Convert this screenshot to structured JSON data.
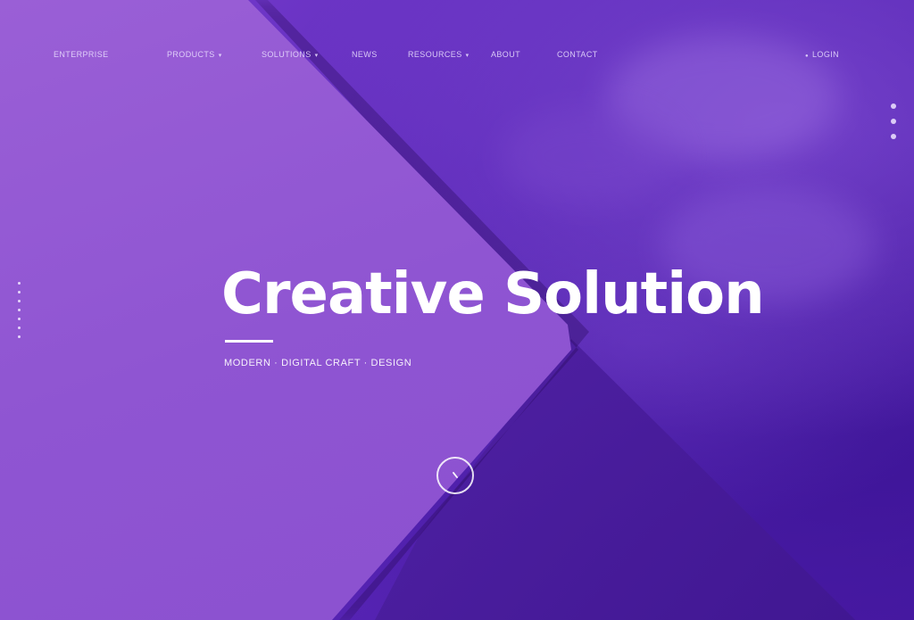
{
  "nav": {
    "brand": "ENTERPRISE",
    "items": [
      {
        "label": "PRODUCTS",
        "has_dropdown": true
      },
      {
        "label": "SOLUTIONS",
        "has_dropdown": true
      },
      {
        "label": "NEWS",
        "has_dropdown": false
      },
      {
        "label": "RESOURCES",
        "has_dropdown": true
      },
      {
        "label": "ABOUT",
        "has_dropdown": false
      },
      {
        "label": "CONTACT",
        "has_dropdown": false
      }
    ],
    "right_link": "LOGIN",
    "dropdown_glyph": "▾"
  },
  "hero": {
    "title": "Creative Solution",
    "subtitle": "MODERN · DIGITAL CRAFT · DESIGN"
  },
  "side_dots": {
    "right_count": 3,
    "left_count": 7
  },
  "icons": {
    "scroll": "arrow-down-icon"
  },
  "colors": {
    "panel_left": "#8f55d2",
    "background_deep": "#4a1ca0",
    "accent_text": "#ffffff"
  }
}
